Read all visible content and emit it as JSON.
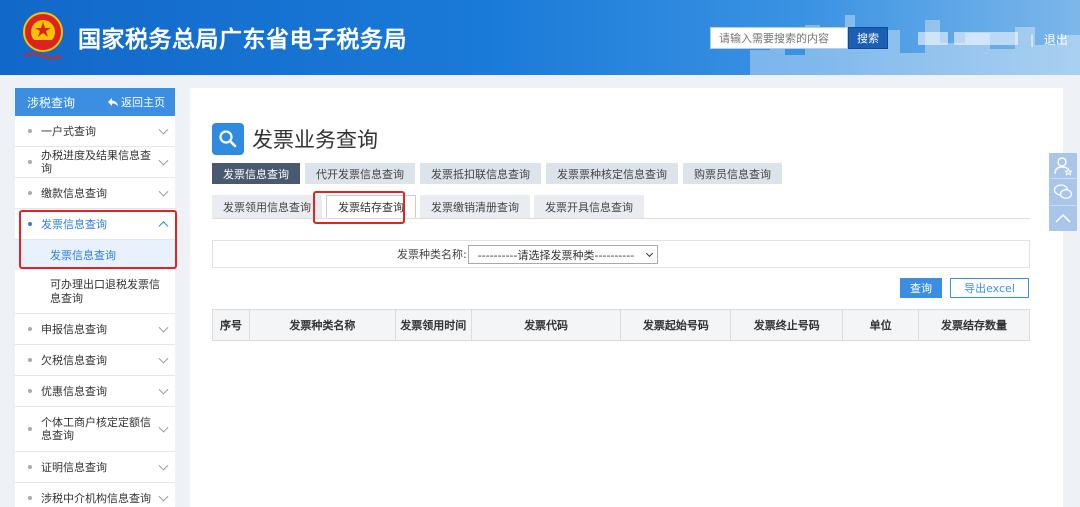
{
  "header": {
    "site_title": "国家税务总局广东省电子税务局",
    "search_placeholder": "请输入需要搜索的内容",
    "search_button": "搜索",
    "logout": "退出",
    "separator": "|"
  },
  "sidebar": {
    "title": "涉税查询",
    "back_home": "返回主页",
    "items": [
      {
        "label": "一户式查询"
      },
      {
        "label": "办税进度及结果信息查询"
      },
      {
        "label": "缴款信息查询"
      },
      {
        "label": "发票信息查询",
        "expanded": true,
        "children": [
          {
            "label": "发票信息查询"
          },
          {
            "label": "可办理出口退税发票信息查询"
          }
        ]
      },
      {
        "label": "申报信息查询"
      },
      {
        "label": "欠税信息查询"
      },
      {
        "label": "优惠信息查询"
      },
      {
        "label": "个体工商户核定定额信息查询"
      },
      {
        "label": "证明信息查询"
      },
      {
        "label": "涉税中介机构信息查询"
      }
    ]
  },
  "main": {
    "page_title": "发票业务查询",
    "tabs_row1": [
      {
        "label": "发票信息查询",
        "active": true
      },
      {
        "label": "代开发票信息查询"
      },
      {
        "label": "发票抵扣联信息查询"
      },
      {
        "label": "发票票种核定信息查询"
      },
      {
        "label": "购票员信息查询"
      }
    ],
    "tabs_row2": [
      {
        "label": "发票领用信息查询"
      },
      {
        "label": "发票结存查询",
        "active": true
      },
      {
        "label": "发票缴销清册查询"
      },
      {
        "label": "发票开具信息查询"
      }
    ],
    "filter": {
      "label": "发票种类名称:",
      "select_value": "----------请选择发票种类----------"
    },
    "buttons": {
      "query": "查询",
      "export": "导出excel"
    },
    "table": {
      "columns": [
        "序号",
        "发票种类名称",
        "发票领用时间",
        "发票代码",
        "发票起始号码",
        "发票终止号码",
        "单位",
        "发票结存数量"
      ]
    }
  },
  "float_toolbar": {
    "icons": [
      "user-star-icon",
      "chat-bubbles-icon",
      "chevron-up-icon"
    ]
  },
  "colors": {
    "header_blue": "#1a7ad8",
    "sidebar_head": "#3c8fe0",
    "active_tab": "#495970",
    "highlight_red": "#e02424",
    "link_blue": "#2f7fd8"
  }
}
